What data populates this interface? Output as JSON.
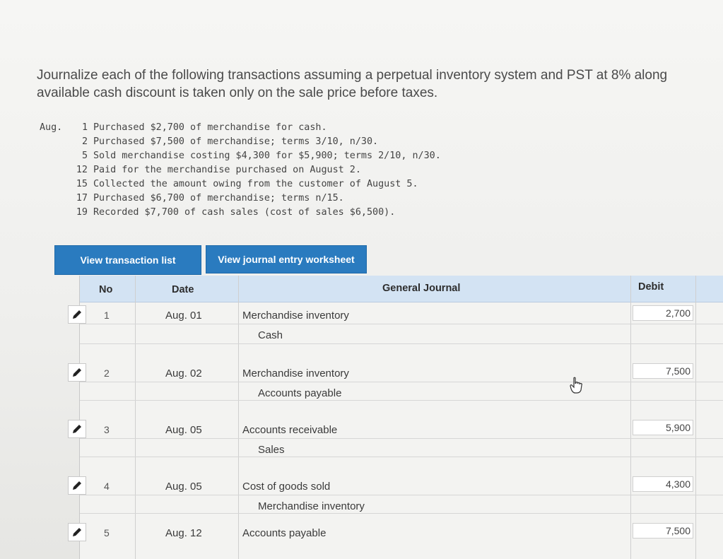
{
  "instructions": {
    "line1": "Journalize each of the following transactions assuming a perpetual inventory system and PST at 8% along",
    "line2": "available cash discount is taken only on the sale price before taxes."
  },
  "transactions": {
    "month": "Aug.",
    "items": [
      {
        "day": "1",
        "text": "Purchased $2,700 of merchandise for cash."
      },
      {
        "day": "2",
        "text": "Purchased $7,500 of merchandise; terms 3/10, n/30."
      },
      {
        "day": "5",
        "text": "Sold merchandise costing $4,300 for $5,900; terms 2/10, n/30."
      },
      {
        "day": "12",
        "text": "Paid for the merchandise purchased on August 2."
      },
      {
        "day": "15",
        "text": "Collected the amount owing from the customer of August 5."
      },
      {
        "day": "17",
        "text": "Purchased $6,700 of merchandise; terms n/15."
      },
      {
        "day": "19",
        "text": "Recorded $7,700 of cash sales (cost of sales $6,500)."
      }
    ]
  },
  "buttons": {
    "view_transactions": "View transaction list",
    "view_worksheet": "View journal entry worksheet"
  },
  "journal": {
    "headers": {
      "no": "No",
      "date": "Date",
      "general_journal": "General Journal",
      "debit": "Debit"
    },
    "rows": [
      {
        "no": "1",
        "date": "Aug. 01",
        "account1": "Merchandise inventory",
        "account2": "Cash",
        "debit": "2,700"
      },
      {
        "no": "2",
        "date": "Aug. 02",
        "account1": "Merchandise inventory",
        "account2": "Accounts payable",
        "debit": "7,500"
      },
      {
        "no": "3",
        "date": "Aug. 05",
        "account1": "Accounts receivable",
        "account2": "Sales",
        "debit": "5,900"
      },
      {
        "no": "4",
        "date": "Aug. 05",
        "account1": "Cost of goods sold",
        "account2": "Merchandise inventory",
        "debit": "4,300"
      },
      {
        "no": "5",
        "date": "Aug. 12",
        "account1": "Accounts payable",
        "account2": "",
        "debit": "7,500"
      }
    ]
  },
  "icons": {
    "edit": "pencil-icon",
    "cursor": "hand-cursor-icon"
  },
  "colors": {
    "button_blue": "#2a7bbf",
    "header_blue": "#d3e3f3"
  }
}
